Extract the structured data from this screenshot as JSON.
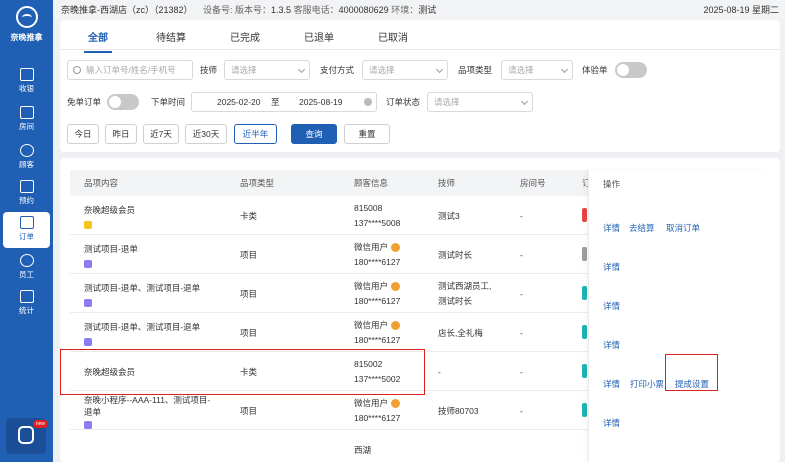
{
  "sidebar": {
    "logo_text": "奈晚推拿",
    "items": [
      {
        "label": "收银",
        "icon": "monitor-icon"
      },
      {
        "label": "房间",
        "icon": "home-icon"
      },
      {
        "label": "顾客",
        "icon": "user-icon"
      },
      {
        "label": "预约",
        "icon": "calendar-clock-icon"
      },
      {
        "label": "订单",
        "icon": "order-icon",
        "active": true
      },
      {
        "label": "员工",
        "icon": "staff-icon"
      },
      {
        "label": "统计",
        "icon": "chart-icon"
      }
    ],
    "badge_new": "new"
  },
  "topbar": {
    "store": "奈晚推拿-西湖店（zc）（21382）",
    "device_label": "设备号:",
    "version_label": "版本号：",
    "version": "1.3.5",
    "phone_label": "客服电话：",
    "phone": "4000080629",
    "env_label": "环境：",
    "env": "测试",
    "date": "2025-08-19 星期二"
  },
  "tabs": [
    "全部",
    "待结算",
    "已完成",
    "已退单",
    "已取消"
  ],
  "filters": {
    "search_placeholder": "输入订单号/姓名/手机号",
    "technician_label": "技师",
    "technician_placeholder": "请选择",
    "payment_label": "支付方式",
    "payment_placeholder": "请选择",
    "item_type_label": "品项类型",
    "item_type_placeholder": "请选择",
    "trial_label": "体验单",
    "free_label": "免单订单",
    "time_label": "下单时间",
    "date_from": "2025-02-20",
    "date_to_sep": "至",
    "date_to": "2025-08-19",
    "status_label": "订单状态",
    "status_placeholder": "请选择",
    "quick": [
      "今日",
      "昨日",
      "近7天",
      "近30天",
      "近半年"
    ],
    "query_label": "查询",
    "reset_label": "重置"
  },
  "table": {
    "headers": [
      "品项内容",
      "品项类型",
      "顾客信息",
      "技师",
      "房间号",
      "订",
      "操作"
    ],
    "rows": [
      {
        "item": "奈晚超级会员",
        "item2": "",
        "tag": "yellow",
        "type": "卡类",
        "customer": "815008",
        "phone": "137****5008",
        "wx": false,
        "tech": "测试3",
        "tech2": "",
        "room": "-",
        "status_color": "#e84545",
        "ops": [
          "详情",
          "去结算",
          "取消订单"
        ]
      },
      {
        "item": "测试项目-退单",
        "item2": "",
        "tag": "purple",
        "type": "项目",
        "customer": "微信用户",
        "phone": "180****6127",
        "wx": true,
        "tech": "测试时长",
        "tech2": "",
        "room": "-",
        "status_color": "#9e9e9e",
        "ops": [
          "详情"
        ]
      },
      {
        "item": "测试项目-退单、测试项目-退单",
        "item2": "",
        "tag": "purple",
        "type": "项目",
        "customer": "微信用户",
        "phone": "180****6127",
        "wx": true,
        "tech": "测试西湖员工,",
        "tech2": "测试时长",
        "room": "-",
        "status_color": "#1cb5b5",
        "ops": [
          "详情"
        ]
      },
      {
        "item": "测试项目-退单、测试项目-退单",
        "item2": "",
        "tag": "purple",
        "type": "项目",
        "customer": "微信用户",
        "phone": "180****6127",
        "wx": true,
        "tech": "店长,全礼梅",
        "tech2": "",
        "room": "-",
        "status_color": "#1cb5b5",
        "ops": [
          "详情"
        ]
      },
      {
        "item": "奈晚超级会员",
        "item2": "",
        "tag": "",
        "type": "卡类",
        "customer": "815002",
        "phone": "137****5002",
        "wx": false,
        "tech": "-",
        "tech2": "",
        "room": "-",
        "status_color": "#1cb5b5",
        "ops": [
          "详情",
          "打印小票",
          "提成设置"
        ]
      },
      {
        "item": "奈晚小程序--AAA-111、测试项目-",
        "item2": "退单",
        "tag": "purple",
        "type": "项目",
        "customer": "微信用户",
        "phone": "180****6127",
        "wx": true,
        "tech": "技师80703",
        "tech2": "",
        "room": "-",
        "status_color": "#1cb5b5",
        "ops": [
          "详情"
        ]
      }
    ],
    "partial_customer": "西湖"
  }
}
